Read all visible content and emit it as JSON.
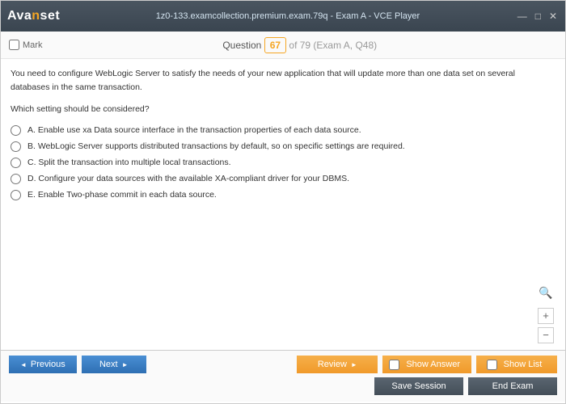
{
  "window": {
    "logo_prefix": "Ava",
    "logo_accent": "n",
    "logo_suffix": "set",
    "title": "1z0-133.examcollection.premium.exam.79q - Exam A - VCE Player"
  },
  "subheader": {
    "mark_label": "Mark",
    "question_label": "Question",
    "current": "67",
    "total_suffix": " of 79 (Exam A, Q48)"
  },
  "question": {
    "stem": "You need to configure WebLogic Server to satisfy the needs of your new application that will update more than one data set on several databases in the same transaction.",
    "prompt": "Which setting should be considered?",
    "options": [
      "A.   Enable use xa Data source interface in the transaction properties of each data source.",
      "B.   WebLogic Server supports distributed transactions by default, so on specific settings are required.",
      "C.   Split the transaction into multiple local transactions.",
      "D.   Configure your data sources with the available XA-compliant driver for your DBMS.",
      "E.   Enable Two-phase commit in each data source."
    ]
  },
  "footer": {
    "previous": "Previous",
    "next": "Next",
    "review": "Review",
    "show_answer": "Show Answer",
    "show_list": "Show List",
    "save_session": "Save Session",
    "end_exam": "End Exam"
  }
}
